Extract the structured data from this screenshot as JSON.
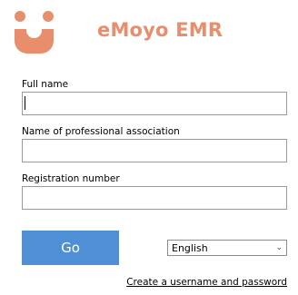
{
  "brand": {
    "title": "eMoyo EMR",
    "logo_icon": "emoyo-smiley-logo-icon",
    "accent_color": "#e98e6c"
  },
  "form": {
    "full_name_label": "Full name",
    "full_name_value": "",
    "professional_association_label": "Name of professional association",
    "professional_association_value": "",
    "registration_number_label": "Registration number",
    "registration_number_value": ""
  },
  "actions": {
    "go_label": "Go",
    "go_color": "#4f8fd6",
    "language_selected": "English",
    "create_account_link": "Create a username and password"
  }
}
